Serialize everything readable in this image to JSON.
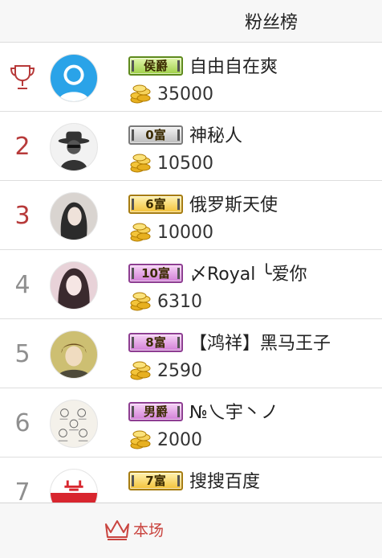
{
  "header": {
    "title": "粉丝榜"
  },
  "rows": [
    {
      "rank": "",
      "badge": "侯爵",
      "name": "自由自在爽",
      "coins": "35000"
    },
    {
      "rank": "2",
      "badge": "0富",
      "name": "神秘人",
      "coins": "10500"
    },
    {
      "rank": "3",
      "badge": "6富",
      "name": "俄罗斯天使",
      "coins": "10000"
    },
    {
      "rank": "4",
      "badge": "10富",
      "name": "〆Royal ╰爱你",
      "coins": "6310"
    },
    {
      "rank": "5",
      "badge": "8富",
      "name": "【鸿祥】黑马王子",
      "coins": "2590"
    },
    {
      "rank": "6",
      "badge": "男爵",
      "name": "№乀宇丶ノ",
      "coins": "2000"
    },
    {
      "rank": "7",
      "badge": "7富",
      "name": "搜搜百度",
      "coins": ""
    }
  ],
  "footer": {
    "tab_label": "本场"
  },
  "colors": {
    "accent": "#c9443f",
    "rank_top": "#b73a3a",
    "rank_other": "#8f8f8f"
  }
}
